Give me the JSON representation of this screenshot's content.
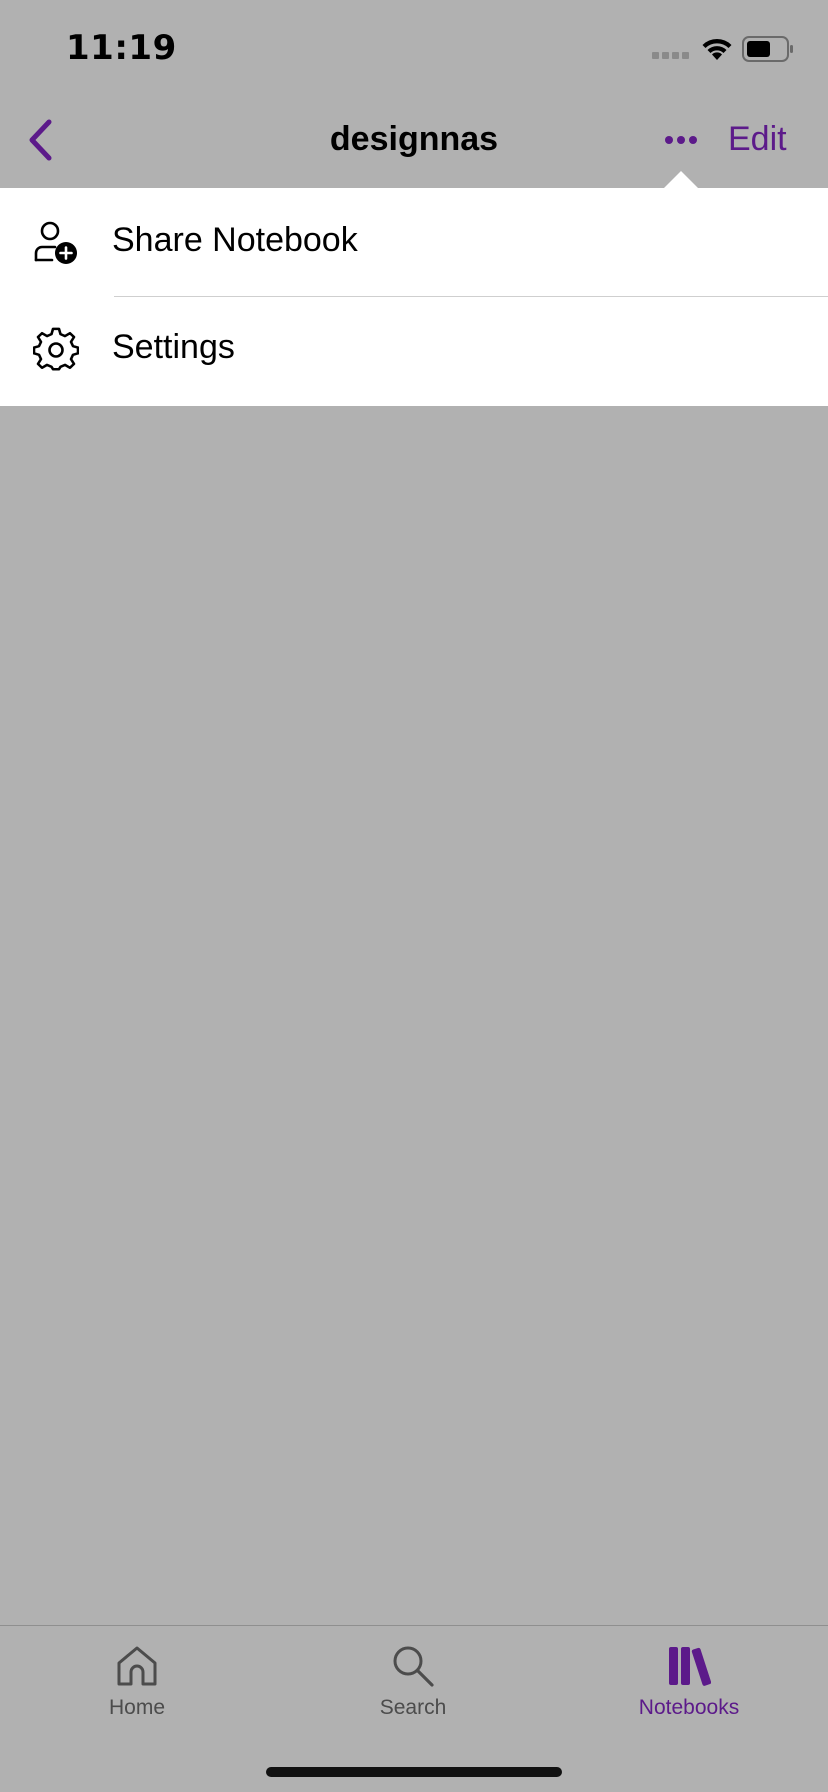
{
  "status_bar": {
    "time": "11:19",
    "icons": [
      "cellular-signal-icon",
      "wifi-icon",
      "battery-icon"
    ]
  },
  "nav_bar": {
    "title": "designnas",
    "back_icon": "chevron-left-icon",
    "more_icon": "ellipsis-icon",
    "edit_label": "Edit"
  },
  "menu": {
    "items": [
      {
        "label": "Share Notebook",
        "icon": "person-add-icon"
      },
      {
        "label": "Settings",
        "icon": "gear-icon"
      }
    ]
  },
  "tab_bar": {
    "tabs": [
      {
        "label": "Home",
        "icon": "home-icon",
        "active": false
      },
      {
        "label": "Search",
        "icon": "search-icon",
        "active": false
      },
      {
        "label": "Notebooks",
        "icon": "notebooks-icon",
        "active": true
      }
    ]
  },
  "colors": {
    "accent": "#5c1a8a",
    "background_dimmed": "#b1b1b1",
    "menu_background": "#ffffff"
  }
}
